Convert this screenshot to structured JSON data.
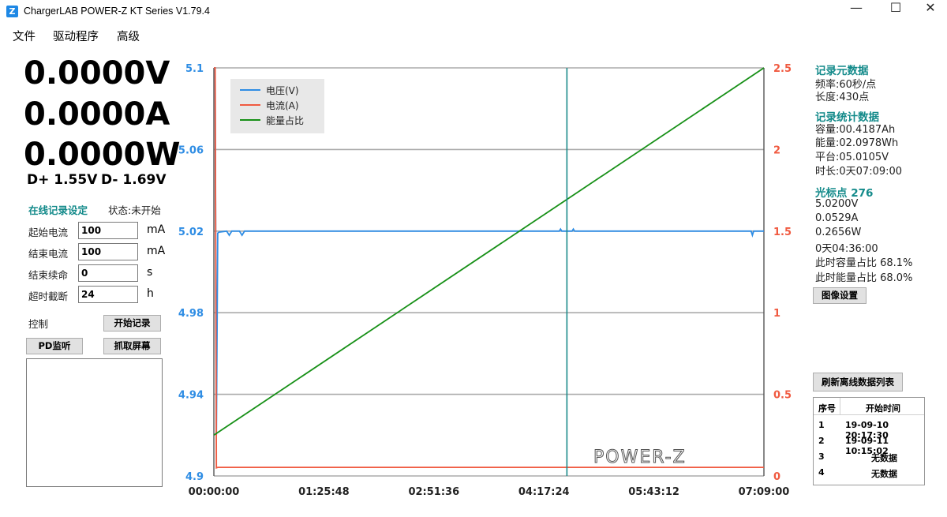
{
  "window": {
    "title": "ChargerLAB POWER-Z KT Series V1.79.4",
    "icon_glyph": "Z",
    "minimize": "—",
    "maximize": "☐",
    "close": "✕"
  },
  "menu": [
    "文件",
    "驱动程序",
    "高级"
  ],
  "readings": {
    "voltage": "0.0000V",
    "current": "0.0000A",
    "power": "0.0000W",
    "dplus": "D+ 1.55V",
    "dminus": "D- 1.69V"
  },
  "online": {
    "title": "在线记录设定",
    "status": "状态:未开始",
    "fields": [
      {
        "label": "起始电流",
        "value": "100",
        "unit": "mA"
      },
      {
        "label": "结束电流",
        "value": "100",
        "unit": "mA"
      },
      {
        "label": "结束续命",
        "value": "0",
        "unit": "s"
      },
      {
        "label": "超时截断",
        "value": "24",
        "unit": "h"
      }
    ],
    "control_label": "控制",
    "start_button": "开始记录",
    "pd_button": "PD监听",
    "capture_button": "抓取屏幕"
  },
  "right_panel": {
    "meta_title": "记录元数据",
    "freq": "频率:60秒/点",
    "length": "长度:430点",
    "stats_title": "记录统计数据",
    "capacity": "容量:00.4187Ah",
    "energy": "能量:02.0978Wh",
    "plateau": "平台:05.0105V",
    "duration": "时长:0天07:09:00",
    "cursor_title": "光标点 276",
    "cursor_v": "5.0200V",
    "cursor_a": "0.0529A",
    "cursor_w": "0.2656W",
    "cursor_time": "0天04:36:00",
    "cursor_cap": "此时容量占比 68.1%",
    "cursor_energy": "此时能量占比 68.0%",
    "image_settings_button": "图像设置",
    "refresh_button": "刷新离线数据列表",
    "table": {
      "headers": [
        "序号",
        "开始时间"
      ],
      "rows": [
        [
          "1",
          "19-09-10 20:17:30"
        ],
        [
          "2",
          "19-09-11 10:15:02"
        ],
        [
          "3",
          "无数据"
        ],
        [
          "4",
          "无数据"
        ]
      ]
    }
  },
  "chart_data": {
    "type": "line",
    "left_axis": {
      "ticks": [
        "5.1",
        "5.06",
        "5.02",
        "4.98",
        "4.94",
        "4.9"
      ],
      "ylim": [
        4.9,
        5.1
      ],
      "color": "#2f8de4"
    },
    "right_axis": {
      "ticks": [
        "2.5",
        "2",
        "1.5",
        "1",
        "0.5",
        "0"
      ],
      "ylim": [
        0,
        2.5
      ],
      "color": "#f05a40"
    },
    "x_ticks": [
      "00:00:00",
      "01:25:48",
      "02:51:36",
      "04:17:24",
      "05:43:12",
      "07:09:00"
    ],
    "xlim_points": [
      0,
      430
    ],
    "cursor_point": 276,
    "grid": true,
    "legend_position": "top-left",
    "series": [
      {
        "name": "电压(V)",
        "color": "#2f8de4",
        "axis": "left",
        "points": [
          [
            0,
            5.1
          ],
          [
            1,
            5.1
          ],
          [
            2,
            4.92
          ],
          [
            3,
            5.019
          ],
          [
            4,
            5.0195
          ],
          [
            10,
            5.02
          ],
          [
            12,
            5.018
          ],
          [
            14,
            5.02
          ],
          [
            20,
            5.02
          ],
          [
            22,
            5.018
          ],
          [
            24,
            5.02
          ],
          [
            270,
            5.02
          ],
          [
            271,
            5.021
          ],
          [
            272,
            5.02
          ],
          [
            280,
            5.02
          ],
          [
            281,
            5.021
          ],
          [
            282,
            5.02
          ],
          [
            420,
            5.02
          ],
          [
            421,
            5.018
          ],
          [
            422,
            5.02
          ],
          [
            430,
            5.02
          ]
        ]
      },
      {
        "name": "电流(A)",
        "color": "#f05a40",
        "axis": "right",
        "points": [
          [
            0,
            2.5
          ],
          [
            1,
            2.5
          ],
          [
            2,
            0.05
          ],
          [
            3,
            0.0529
          ],
          [
            430,
            0.0529
          ]
        ]
      },
      {
        "name": "能量占比",
        "color": "#179017",
        "axis": "right",
        "points": [
          [
            0,
            0.25
          ],
          [
            430,
            2.5
          ]
        ]
      }
    ],
    "watermark": "POWER-Z"
  },
  "colors": {
    "teal": "#138a8a",
    "grid": "#ababab",
    "cursor": "#1a8a8a",
    "legend_bg": "#e8e8e8"
  }
}
